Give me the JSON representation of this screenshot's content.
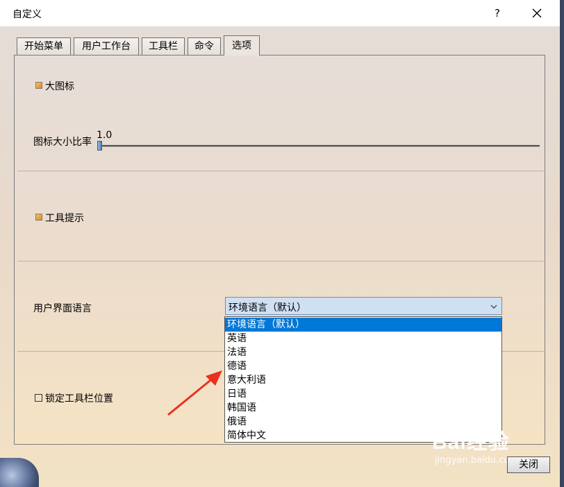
{
  "window": {
    "title": "自定义",
    "help_label": "?"
  },
  "tabs": [
    {
      "label": "开始菜单"
    },
    {
      "label": "用户工作台"
    },
    {
      "label": "工具栏"
    },
    {
      "label": "命令"
    },
    {
      "label": "选项"
    }
  ],
  "active_tab": "选项",
  "options": {
    "large_icons_label": "大图标",
    "large_icons_checked": true,
    "icon_ratio_label": "图标大小比率",
    "icon_ratio_value": "1.0",
    "tooltips_label": "工具提示",
    "tooltips_checked": true,
    "ui_language_label": "用户界面语言",
    "ui_language_selected": "环境语言（默认）",
    "lock_toolbar_label": "锁定工具栏位置",
    "lock_toolbar_checked": false
  },
  "language_options": [
    "环境语言（默认）",
    "英语",
    "法语",
    "德语",
    "意大利语",
    "日语",
    "韩国语",
    "俄语",
    "简体中文"
  ],
  "buttons": {
    "close_label": "关闭"
  },
  "watermark": {
    "main": "Bai经验",
    "sub": "jingyan.baidu.com"
  },
  "colors": {
    "selection": "#0078d7",
    "annotation_arrow": "#e8321e",
    "checkbox_orange": "#d88a1e"
  }
}
